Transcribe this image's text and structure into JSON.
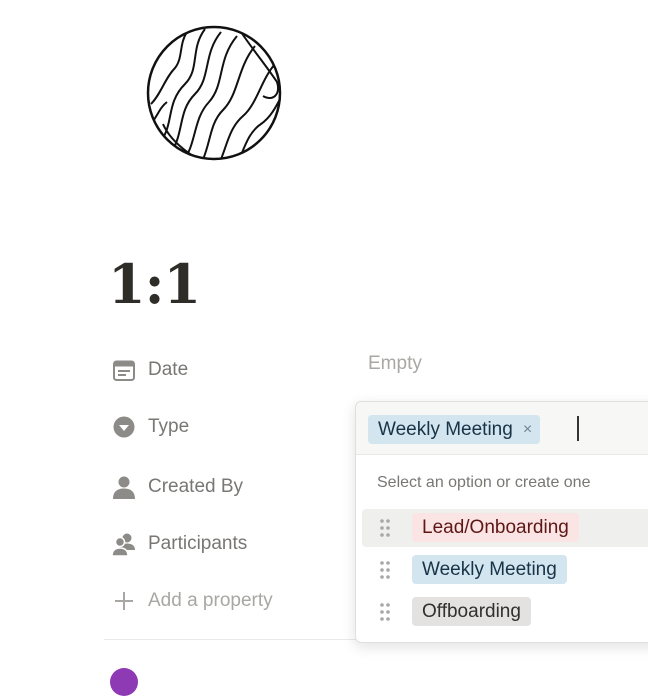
{
  "page": {
    "title": "1:1",
    "icon": "wood-grain-circle-icon"
  },
  "properties": [
    {
      "label": "Date",
      "icon": "calendar-icon",
      "value": "Empty"
    },
    {
      "label": "Type",
      "icon": "select-arrow-icon"
    },
    {
      "label": "Created By",
      "icon": "person-icon"
    },
    {
      "label": "Participants",
      "icon": "people-icon"
    }
  ],
  "add_property": {
    "label": "Add a property",
    "icon": "plus-icon"
  },
  "type_dropdown": {
    "selected_chip": "Weekly Meeting",
    "remove_icon": "×",
    "hint": "Select an option or create one",
    "options": [
      {
        "label": "Lead/Onboarding",
        "bg": "#fbe4e4",
        "color": "#5d1715"
      },
      {
        "label": "Weekly Meeting",
        "bg": "#d3e5ef",
        "color": "#183347"
      },
      {
        "label": "Offboarding",
        "bg": "#e3e2e0",
        "color": "#32302c"
      }
    ]
  },
  "colors": {
    "text_primary": "#37352f",
    "text_secondary": "#787774",
    "placeholder": "#a8a7a3",
    "chip_blue_bg": "#d3e5ef",
    "avatar_purple": "#8e3ab5"
  }
}
